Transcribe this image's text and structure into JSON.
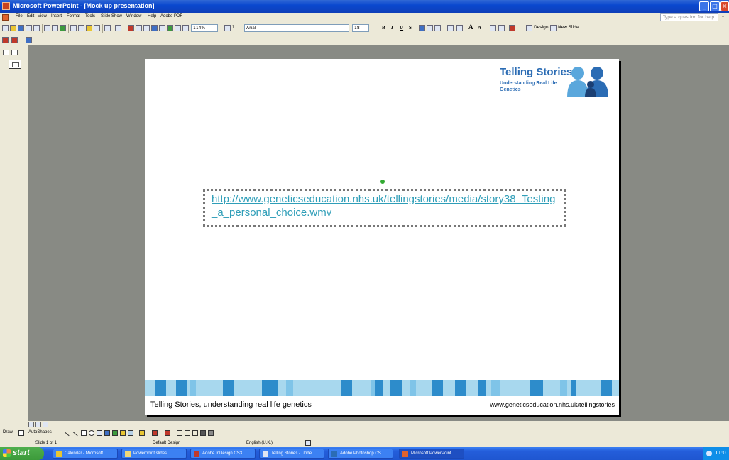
{
  "window": {
    "title": "Microsoft PowerPoint - [Mock up presentation]",
    "min_glyph": "_",
    "max_glyph": "□",
    "close_glyph": "×"
  },
  "menu": {
    "items": [
      "File",
      "Edit",
      "View",
      "Insert",
      "Format",
      "Tools",
      "Slide Show",
      "Window",
      "Help",
      "Adobe PDF"
    ],
    "help_placeholder": "Type a question for help",
    "help_arrow": "▾"
  },
  "toolbar": {
    "zoom": "114%",
    "help_glyph": "?",
    "font": "Arial",
    "font_size": "18",
    "bold": "B",
    "italic": "I",
    "underline": "U",
    "shadow": "S",
    "grow_font": "A",
    "shrink_font": "A",
    "design_label": "Design",
    "new_slide_label": "New Slide",
    "overflow": "."
  },
  "slide": {
    "logo_title": "Telling Stories",
    "logo_subtitle": "Understanding Real Life Genetics",
    "hyperlink": "http://www.geneticseducation.nhs.uk/tellingstories/media/story38_Testing_a_personal_choice.wmv",
    "footer_left": "Telling Stories, understanding real life genetics",
    "footer_right": "www.geneticseducation.nhs.uk/tellingstories",
    "accent_color": "#2f9eb8",
    "footer_colors": [
      "#2d8ccb",
      "#7fc4e8",
      "#a8d8ee"
    ]
  },
  "drawbar": {
    "draw": "Draw",
    "autoshapes": "AutoShapes"
  },
  "status": {
    "slide": "Slide 1 of 1",
    "design": "Default Design",
    "language": "English (U.K.)"
  },
  "taskbar": {
    "start": "start",
    "items": [
      "Calendar - Microsoft ...",
      "Powerpoint slides",
      "Adobe InDesign CS3 ...",
      "Telling Stories - Unde...",
      "Adobe Photoshop CS...",
      "Microsoft PowerPoint ..."
    ],
    "clock": "11:0"
  }
}
